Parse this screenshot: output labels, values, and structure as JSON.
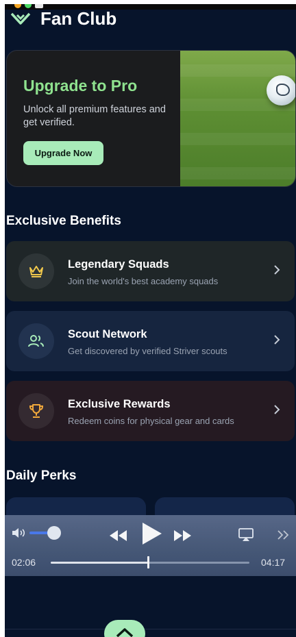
{
  "app": {
    "title": "Fan Club"
  },
  "promo": {
    "title": "Upgrade to Pro",
    "subtitle": "Unlock all premium features and get verified.",
    "button_label": "Upgrade Now"
  },
  "benefits": {
    "section_title": "Exclusive Benefits",
    "items": [
      {
        "title": "Legendary Squads",
        "subtitle": "Join the world's best academy squads",
        "icon": "crown-icon",
        "bg": "#1f2628",
        "icon_color": "#f2c94c"
      },
      {
        "title": "Scout Network",
        "subtitle": "Get discovered by verified Striver scouts",
        "icon": "users-icon",
        "bg": "#16253f",
        "icon_color": "#a8ebb9"
      },
      {
        "title": "Exclusive Rewards",
        "subtitle": "Redeem coins for physical gear and cards",
        "icon": "trophy-icon",
        "bg": "#251a22",
        "icon_color": "#f2a93b"
      }
    ]
  },
  "perks": {
    "section_title": "Daily Perks"
  },
  "player": {
    "current_time": "02:06",
    "total_time": "04:17",
    "progress": 0.49,
    "volume": 0.55
  },
  "colors": {
    "background": "#07142b",
    "accent_green": "#8fe28f",
    "button_green": "#a8ebb9"
  }
}
